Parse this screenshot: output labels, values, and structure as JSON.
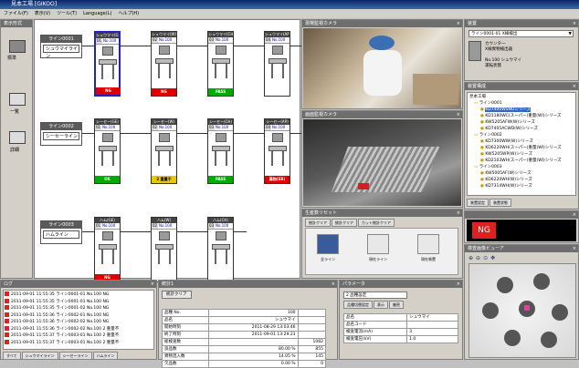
{
  "window_title": "見本工場 [GIKOO]",
  "menu": [
    "ファイル(F)",
    "表示(V)",
    "ツール(T)",
    "Language(L)",
    "ヘルプ(H)"
  ],
  "left_toolbar": {
    "title": "表示形式",
    "items": [
      "標準",
      "一覧",
      "詳細"
    ]
  },
  "lines": [
    {
      "header": "ライン0001",
      "name": "シュウマイライン",
      "units": [
        {
          "title": "シュウマイ(GE)",
          "num": "01",
          "no": "No.100",
          "status": "NG",
          "status_color": "#dd0000"
        },
        {
          "title": "シュウマイ(W)",
          "num": "02",
          "no": "No.100",
          "status": "NG",
          "status_color": "#dd0000"
        },
        {
          "title": "シュウマイ(CH)",
          "num": "03",
          "no": "No.100",
          "status": "PASS",
          "status_color": "#00aa00"
        },
        {
          "title": "シュウマイ(AP)",
          "num": "04",
          "no": "No.100",
          "status": "",
          "status_color": "#ffffff"
        }
      ]
    },
    {
      "header": "ライン0002",
      "name": "シーセーライン",
      "units": [
        {
          "title": "シーセー(GE)",
          "num": "01",
          "no": "No.100",
          "status": "OK",
          "status_color": "#00aa00"
        },
        {
          "title": "シーセー(W)",
          "num": "02",
          "no": "No.100",
          "status": "2 重量不",
          "status_color": "#e8c800"
        },
        {
          "title": "シーセー(CH)",
          "num": "03",
          "no": "No.100",
          "status": "PASS",
          "status_color": "#00aa00"
        },
        {
          "title": "シーセー(AP)",
          "num": "04",
          "no": "No.100",
          "status": "異物(ER)",
          "status_color": "#dd0000"
        }
      ]
    },
    {
      "header": "ライン0003",
      "name": "ハムライン",
      "units": [
        {
          "title": "ハム(GE)",
          "num": "01",
          "no": "No.100",
          "status": "NG",
          "status_color": "#dd0000"
        },
        {
          "title": "ハム(W)",
          "num": "02",
          "no": "No.100",
          "status": "",
          "status_color": "#ffffff"
        },
        {
          "title": "ハム(CH)",
          "num": "03",
          "no": "No.100",
          "status": "",
          "status_color": "#ffffff"
        }
      ]
    }
  ],
  "camera1_title": "現場監視カメラ",
  "camera2_title": "画面監視カメラ",
  "reset_panel": {
    "title": "生産数リセット",
    "tabs": [
      "統計クリア",
      "統計クリア",
      "カット統計クリア"
    ],
    "buttons": [
      "全ライン",
      "現在ライン",
      "現在装置"
    ]
  },
  "info_panel": {
    "title": "装置",
    "select": "ライン0001-01 X線検出",
    "lines": [
      "カウンタ一",
      "X線異物検出器"
    ],
    "product": "No.100 シュウマイ",
    "extra": "運転状態"
  },
  "tree_panel": {
    "title": "装置構成",
    "root": "見本工場",
    "items": [
      "ライン0001",
      "KD7400WSNOシリーズ",
      "KD1180WC(スーパー)重量(WI)シリーズ",
      "KW5205AFW(W)シリーズ",
      "KD7405ACWD(W)シリーズ",
      "ライン0002",
      "KD7300WW(W)シリーズ",
      "KD6220WH(スーパー)重量(WI)シリーズ",
      "KW5205WP(W)シリーズ",
      "KD2103WH(スーパー)重量(WI)シリーズ",
      "ライン0003",
      "KW5005AF(W)シリーズ",
      "KD6220WH(W)シリーズ",
      "KD7314WH(W)シリーズ"
    ],
    "tabs": [
      "装置設定",
      "装置状態"
    ]
  },
  "ng_panel": {
    "label": "NG"
  },
  "image_panel": {
    "title": "検査画像ビューア"
  },
  "log_panel": {
    "title": "ログ",
    "rows": [
      "2011-09-01 11:55:35 ライン0001-01 No.100 NG",
      "2011-09-01 11:55:35 ライン0001-01 No.100 NG",
      "2011-09-01 11:55:35 ライン0001-02 No.100 NG",
      "2011-09-01 11:55:36 ライン0002-01 No.100 NG",
      "2011-09-01 11:55:36 ライン0002-02 No.100 NG",
      "2011-09-01 11:55:36 ライン0002-02 No.100 2 重量不",
      "2011-09-01 11:55:37 ライン0003-01 No.100 2 重量不",
      "2011-09-01 11:55:37 ライン0003-01 No.100 2 重量不"
    ],
    "tabs": [
      "すべて",
      "シュウマイライン",
      "シーセーライン",
      "ハムライン"
    ]
  },
  "stats_panel": {
    "title": "統計1",
    "clear_btn": "統計クリア",
    "rows": [
      [
        "品種 No.",
        "100",
        ""
      ],
      [
        "品名",
        "シュウマイ",
        ""
      ],
      [
        "開始時刻",
        "2011-08-29 13:03:46",
        ""
      ],
      [
        "終了時刻",
        "2011-09-01 13:29:23",
        ""
      ],
      [
        "総検査数",
        "",
        "1082"
      ],
      [
        "良品数",
        "80.00 %",
        "855"
      ],
      [
        "異物混入数",
        "14.05 %",
        "145"
      ],
      [
        "欠品数",
        "0.00 %",
        "0"
      ]
    ]
  },
  "param_panel": {
    "title": "パラメータ",
    "select": "2 品種設定",
    "tabs": [
      "品種切替設定",
      "表示",
      "厳密"
    ],
    "rows": [
      [
        "品名",
        "シュウマイ"
      ],
      [
        "品名コード",
        ""
      ],
      [
        "検査電流(mA)",
        "3"
      ],
      [
        "検査電圧(kV)",
        "1.0"
      ]
    ]
  }
}
